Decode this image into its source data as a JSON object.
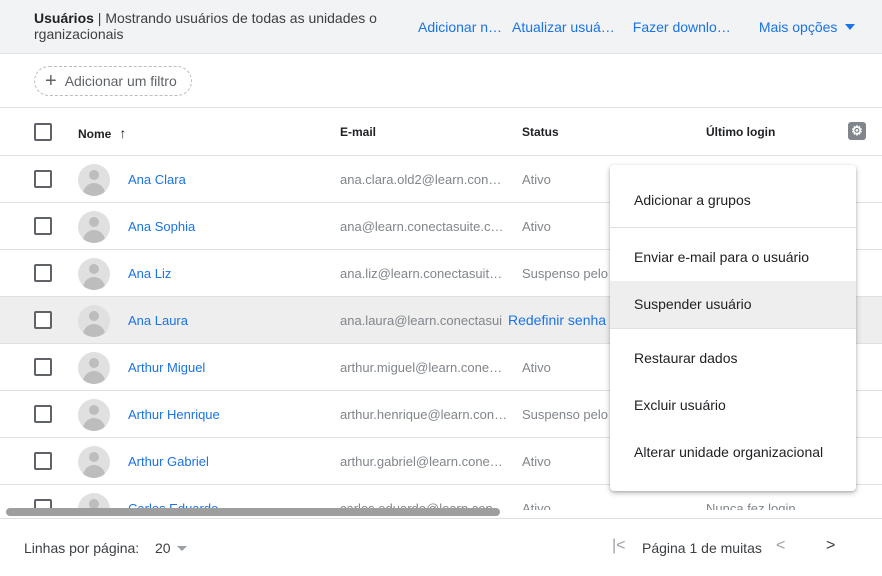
{
  "topbar": {
    "title_bold": "Usuários",
    "title_rest": " | Mostrando usuários de todas as unidades o rganizacionais",
    "actions": [
      "Adicionar n…",
      "Atualizar usuá…",
      "Fazer downlo…",
      "Mais opções"
    ]
  },
  "filter": {
    "label": "Adicionar um filtro"
  },
  "table": {
    "headers": {
      "name": "Nome",
      "email": "E-mail",
      "status": "Status",
      "last_login": "Último login"
    },
    "sort_icon": "↑",
    "rows": [
      {
        "name": "Ana Clara",
        "email": "ana.clara.old2@learn.conec…",
        "status": "Ativo"
      },
      {
        "name": "Ana Sophia",
        "email": "ana@learn.conectasuite.com",
        "status": "Ativo"
      },
      {
        "name": "Ana Liz",
        "email": "ana.liz@learn.conectasuite.…",
        "status": "Suspenso pelo a"
      },
      {
        "name": "Ana Laura",
        "email": "ana.laura@learn.conectasui",
        "action": "Redefinir senha"
      },
      {
        "name": "Arthur Miguel",
        "email": "arthur.miguel@learn.conect…",
        "status": "Ativo"
      },
      {
        "name": "Arthur Henrique",
        "email": "arthur.henrique@learn.cone…",
        "status": "Suspenso pelo a"
      },
      {
        "name": "Arthur Gabriel",
        "email": "arthur.gabriel@learn.conect…",
        "status": "Ativo"
      },
      {
        "name": "Carlos Eduardo",
        "email": "carlos.eduardo@learn.cone…",
        "status": "Ativo",
        "last_login": "Nunca fez login"
      }
    ]
  },
  "context_menu": {
    "items": [
      "Adicionar a grupos",
      "Enviar e-mail para o usuário",
      "Suspender usuário",
      "Restaurar dados",
      "Excluir usuário",
      "Alterar unidade organizacional"
    ]
  },
  "footer": {
    "rows_per_page_label": "Linhas por página:",
    "rows_per_page_value": "20",
    "page_label": "Página 1 de muitas",
    "first_icon": "|<",
    "prev_icon": "<",
    "next_icon": ">"
  },
  "colors": {
    "link": "#1a73e8",
    "header_bg": "#f1f3f4",
    "hover_row": "#eeeeee"
  },
  "icons": [
    "plus-icon",
    "sort-arrow-icon",
    "settings-gear-icon",
    "avatar-icon",
    "dropdown-caret-icon",
    "first-page-icon",
    "prev-page-icon",
    "next-page-icon"
  ]
}
